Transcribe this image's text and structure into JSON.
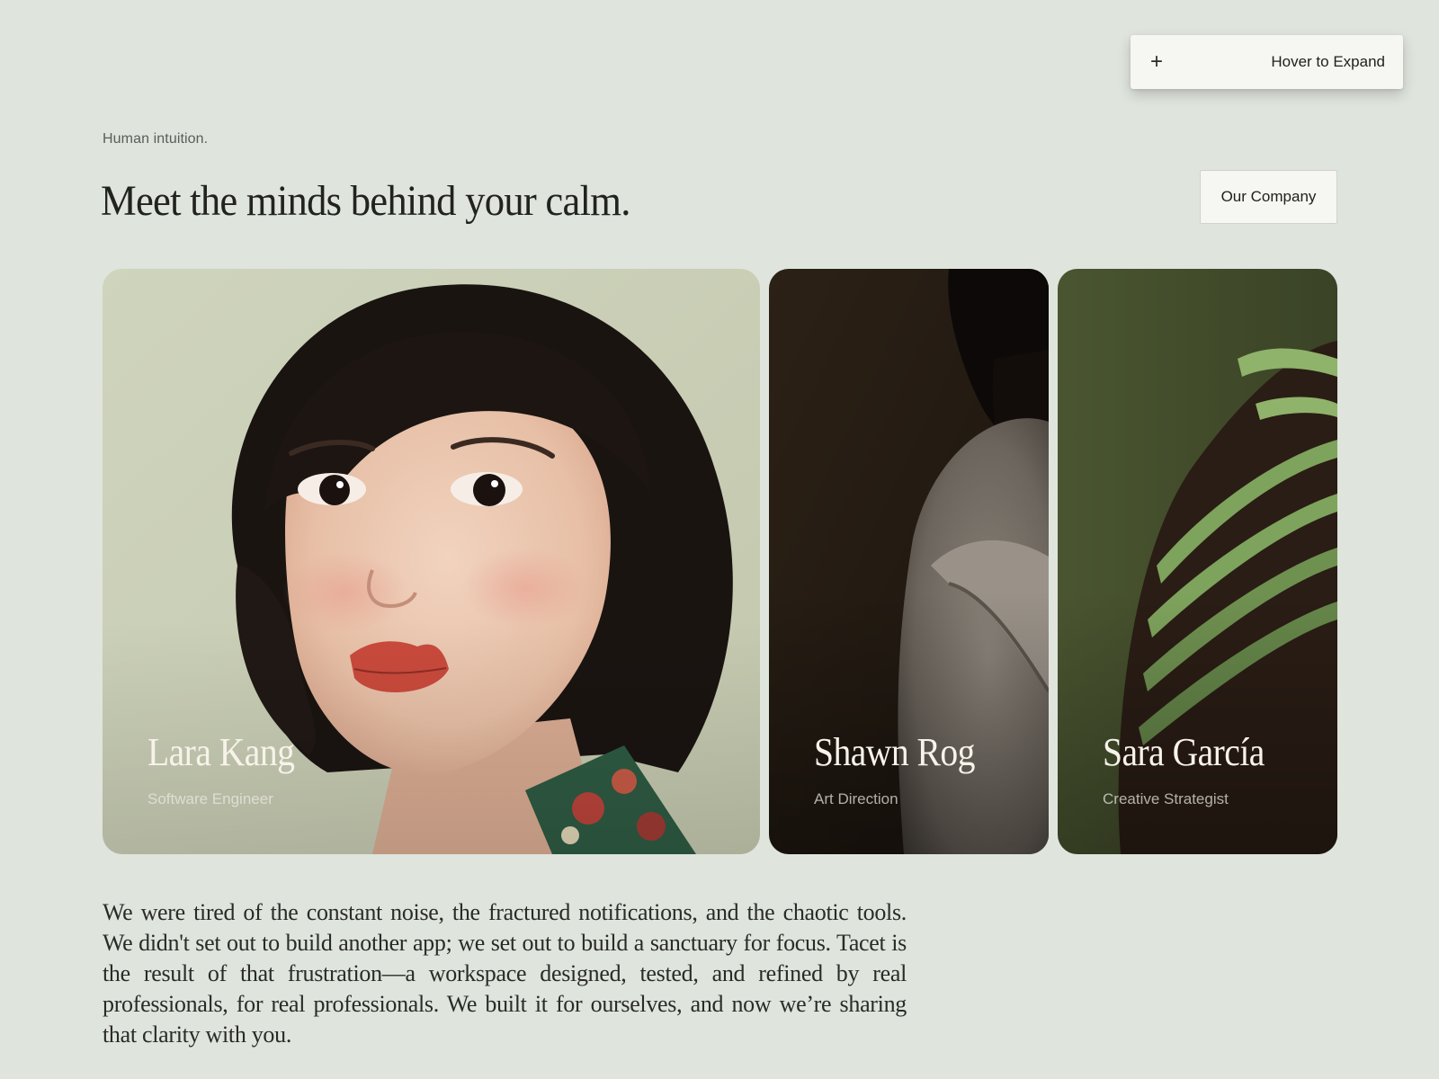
{
  "expand_control": {
    "icon": "plus-icon",
    "label": "Hover to Expand"
  },
  "header": {
    "eyebrow": "Human intuition.",
    "headline": "Meet the minds behind your calm.",
    "company_button": "Our Company"
  },
  "team": [
    {
      "name": "Lara Kang",
      "role": "Software Engineer"
    },
    {
      "name": "Shawn Rog",
      "role": "Art Direction"
    },
    {
      "name": "Sara García",
      "role": "Creative Strategist"
    }
  ],
  "about": {
    "paragraph": "We were tired of the constant noise, the fractured notifications, and the chaotic tools. We didn't set out to build another app; we set out to build a sanctuary for focus. Tacet is the result of that frustration—a workspace designed, tested, and refined by real professionals, for real professionals. We built it for ourselves, and now we’re sharing that clarity with you."
  },
  "colors": {
    "background": "#dfe4dd",
    "surface": "#f6f6f3",
    "text": "#1f1f1c"
  }
}
